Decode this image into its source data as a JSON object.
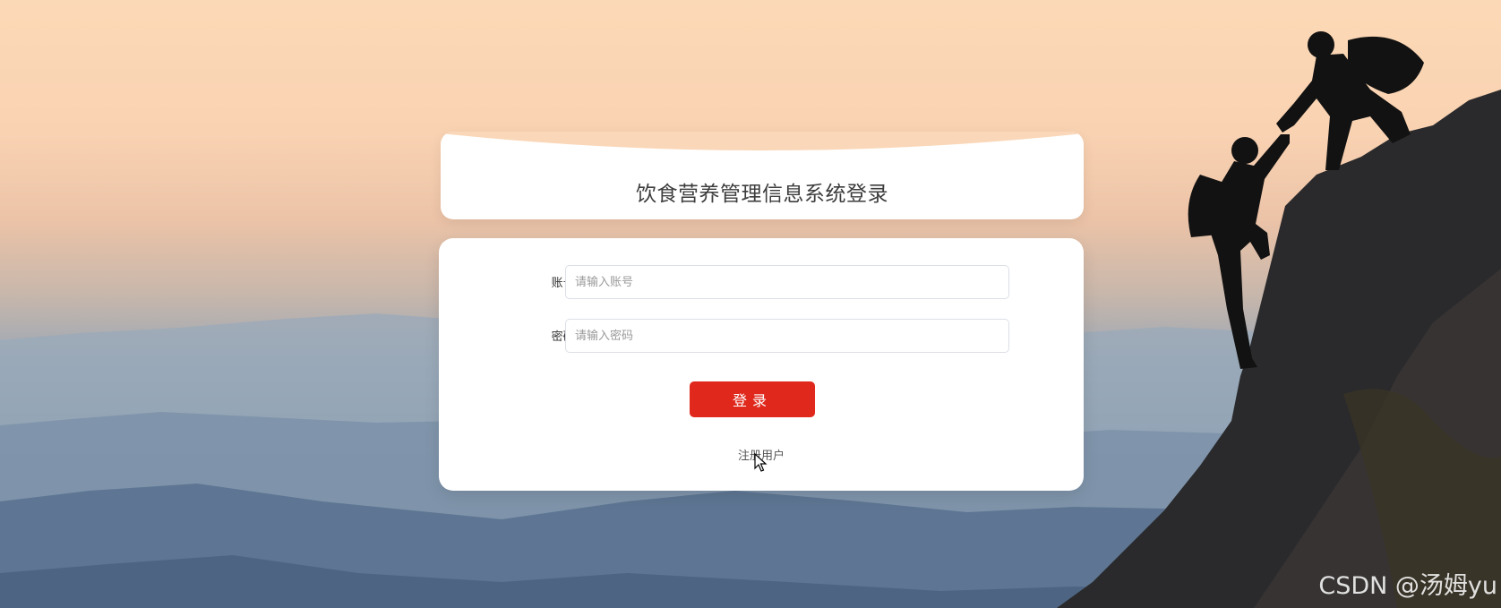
{
  "login": {
    "title": "饮食营养管理信息系统登录",
    "account_label": "账号:",
    "account_placeholder": "请输入账号",
    "account_value": "",
    "password_label": "密码:",
    "password_placeholder": "请输入密码",
    "password_value": "",
    "login_button": "登录",
    "register_link": "注册用户"
  },
  "watermark": "CSDN @汤姆yu",
  "colors": {
    "accent": "#e0281c",
    "card": "#ffffff",
    "sky_top": "#fcd9b6",
    "mountains": "#5f7894"
  }
}
